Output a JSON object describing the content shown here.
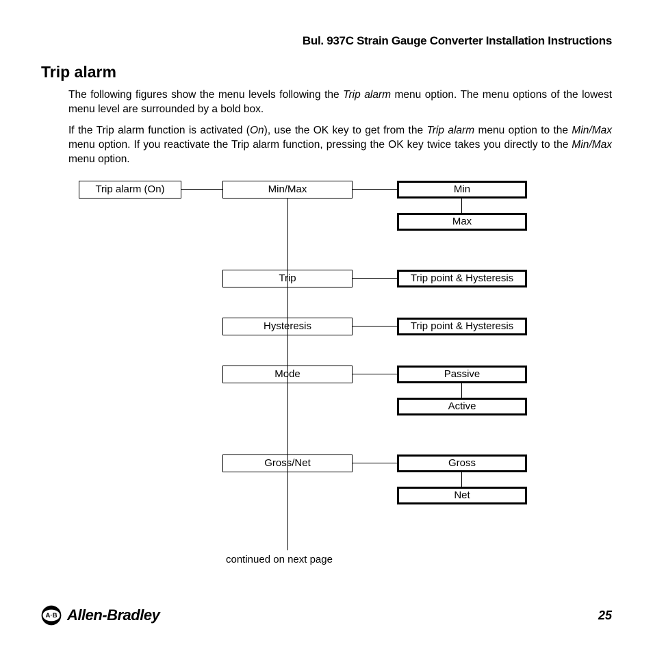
{
  "header": "Bul. 937C Strain Gauge Converter Installation Instructions",
  "section_title": "Trip alarm",
  "para1_a": "The following figures show the menu levels following the ",
  "para1_b": "Trip alarm",
  "para1_c": " menu option. The menu options of the lowest menu level are surrounded by a bold box.",
  "para2_a": "If the Trip alarm function is activated (",
  "para2_b": "On",
  "para2_c": "), use the OK key to get from the ",
  "para2_d": "Trip alarm",
  "para2_e": " menu option to the ",
  "para2_f": "Min/Max",
  "para2_g": " menu option. If you reactivate the Trip alarm function, pressing the OK key twice takes you directly to the ",
  "para2_h": "Min/Max",
  "para2_i": " menu option.",
  "diagram": {
    "root": "Trip alarm (On)",
    "level1": {
      "minmax": "Min/Max",
      "trip": "Trip",
      "hysteresis": "Hysteresis",
      "mode": "Mode",
      "grossnet": "Gross/Net"
    },
    "level2": {
      "min": "Min",
      "max": "Max",
      "trip_ph1": "Trip point & Hysteresis",
      "trip_ph2": "Trip point & Hysteresis",
      "passive": "Passive",
      "active": "Active",
      "gross": "Gross",
      "net": "Net"
    },
    "continued": "continued on next page"
  },
  "footer": {
    "brand": "Allen-Bradley",
    "page": "25"
  }
}
